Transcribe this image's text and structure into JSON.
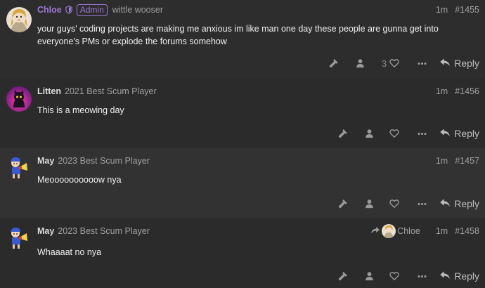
{
  "posts": [
    {
      "username": "Chloe",
      "badge": "Admin",
      "user_title": "wittle wooser",
      "date": "1m",
      "number": "#1455",
      "body": "your guys' coding projects are making me anxious im like man one day these people are gunna get into everyone's PMs or explode the forums somehow",
      "like_count": "3",
      "reply_label": "Reply"
    },
    {
      "username": "Litten",
      "user_title": "2021 Best Scum Player",
      "date": "1m",
      "number": "#1456",
      "body": "This is a meowing day",
      "reply_label": "Reply"
    },
    {
      "username": "May",
      "user_title": "2023 Best Scum Player",
      "date": "1m",
      "number": "#1457",
      "body": "Meoooooooooow nya",
      "reply_label": "Reply"
    },
    {
      "username": "May",
      "user_title": "2023 Best Scum Player",
      "reply_to_user": "Chloe",
      "date": "1m",
      "number": "#1458",
      "body": "Whaaaat no nya",
      "reply_label": "Reply"
    }
  ],
  "colors": {
    "admin_accent": "#9d79d6",
    "background": "#242424",
    "muted_text": "#a0a0a0"
  },
  "icons": [
    "shield-icon",
    "hammer-icon",
    "user-icon",
    "heart-icon",
    "ellipsis-icon",
    "reply-icon",
    "reply-to-arrow-icon"
  ]
}
